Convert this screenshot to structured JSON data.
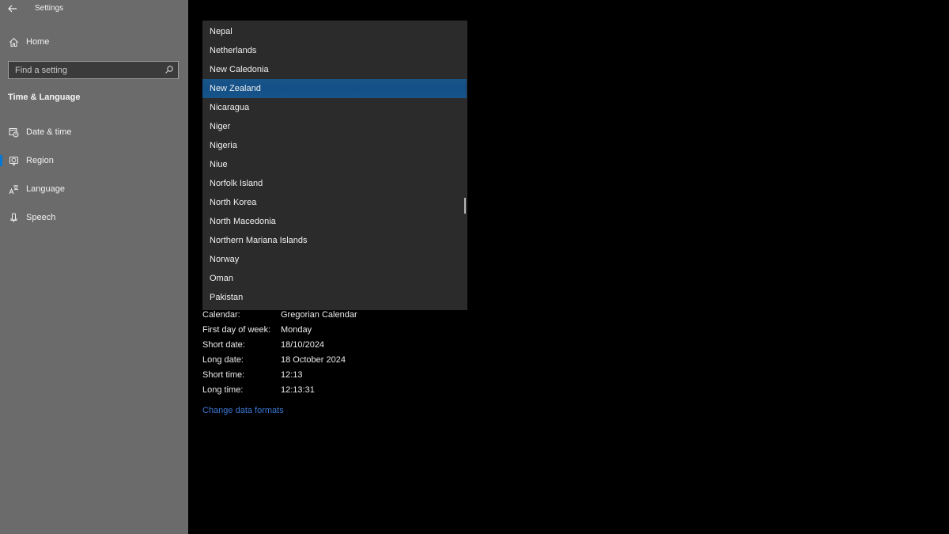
{
  "app": {
    "title": "Settings"
  },
  "sidebar": {
    "home_label": "Home",
    "search": {
      "placeholder": "Find a setting",
      "value": ""
    },
    "section_title": "Time & Language",
    "items": [
      {
        "label": "Date & time",
        "icon": "calendar-clock-icon",
        "active": false
      },
      {
        "label": "Region",
        "icon": "globe-region-icon",
        "active": true
      },
      {
        "label": "Language",
        "icon": "language-icon",
        "active": false
      },
      {
        "label": "Speech",
        "icon": "microphone-icon",
        "active": false
      }
    ]
  },
  "country_dropdown": {
    "selected": "New Zealand",
    "items": [
      "Nepal",
      "Netherlands",
      "New Caledonia",
      "New Zealand",
      "Nicaragua",
      "Niger",
      "Nigeria",
      "Niue",
      "Norfolk Island",
      "North Korea",
      "North Macedonia",
      "Northern Mariana Islands",
      "Norway",
      "Oman",
      "Pakistan"
    ]
  },
  "regional_format_data": {
    "rows": [
      {
        "label": "Calendar:",
        "value": "Gregorian Calendar"
      },
      {
        "label": "First day of week:",
        "value": "Monday"
      },
      {
        "label": "Short date:",
        "value": "18/10/2024"
      },
      {
        "label": "Long date:",
        "value": "18 October 2024"
      },
      {
        "label": "Short time:",
        "value": "12:13"
      },
      {
        "label": "Long time:",
        "value": "12:13:31"
      }
    ],
    "change_link": "Change data formats"
  },
  "colors": {
    "accent": "#0078d7",
    "selection": "#125087",
    "link": "#3a78d4",
    "sidebar_bg": "#6b6b6b",
    "dropdown_bg": "#2b2b2b"
  }
}
